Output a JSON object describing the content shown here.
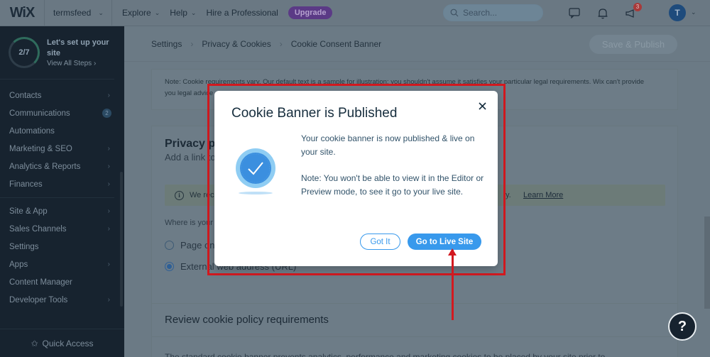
{
  "topbar": {
    "logo": "WiX",
    "site_name": "termsfeed",
    "nav": [
      "Explore",
      "Help",
      "Hire a Professional"
    ],
    "upgrade_label": "Upgrade",
    "search_placeholder": "Search...",
    "notifications_badge": "3",
    "avatar_letter": "T"
  },
  "sidebar": {
    "progress": "2/7",
    "progress_fraction": 0.2857,
    "setup_title": "Let's set up your site",
    "setup_link": "View All Steps",
    "items_group1": [
      {
        "label": "Contacts",
        "arrow": true
      },
      {
        "label": "Communications",
        "badge": "2"
      },
      {
        "label": "Automations"
      },
      {
        "label": "Marketing & SEO",
        "arrow": true
      },
      {
        "label": "Analytics & Reports",
        "arrow": true
      },
      {
        "label": "Finances",
        "arrow": true
      }
    ],
    "items_group2": [
      {
        "label": "Site & App",
        "arrow": true
      },
      {
        "label": "Sales Channels",
        "arrow": true
      },
      {
        "label": "Settings"
      },
      {
        "label": "Apps",
        "arrow": true
      },
      {
        "label": "Content Manager"
      },
      {
        "label": "Developer Tools",
        "arrow": true
      }
    ],
    "quick_access": "Quick Access"
  },
  "main": {
    "breadcrumb": [
      "Settings",
      "Privacy & Cookies",
      "Cookie Consent Banner"
    ],
    "save_publish": "Save & Publish",
    "note_line1": "Note: Cookie requirements vary. Our default text is a sample for illustration; you shouldn't assume it satisfies your particular legal requirements. Wix can't provide",
    "note_line2": "you legal advice",
    "privacy_title": "Privacy p",
    "privacy_sub": "Add a link to",
    "info_text": "We rec",
    "info_tail": "y.",
    "learn_more": "Learn More",
    "where_label": "Where is your",
    "radio_page": "Page on",
    "radio_external": "External web address (URL)",
    "review_title": "Review cookie policy requirements",
    "review_text": "The standard cookie banner prevents analytics, performance and marketing cookies to be placed by your site prior to"
  },
  "modal": {
    "title": "Cookie Banner is Published",
    "body1": "Your cookie banner is now published & live on your site.",
    "body2": "Note: You won't be able to view it in the Editor or Preview mode, to see it go to your live site.",
    "got_it": "Got It",
    "go_live": "Go to Live Site"
  },
  "help_label": "?"
}
